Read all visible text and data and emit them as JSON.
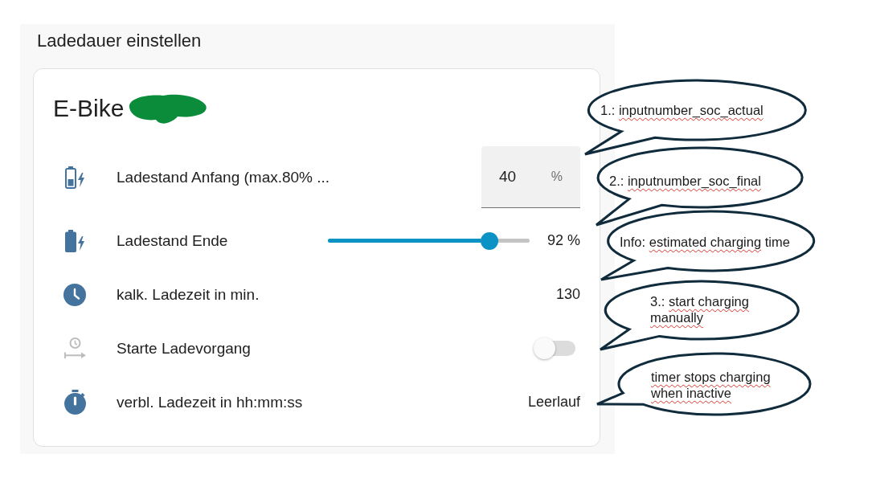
{
  "section_title": "Ladedauer einstellen",
  "card": {
    "title": "E-Bike",
    "redacted": true,
    "rows": [
      {
        "kind": "number",
        "label": "Ladestand Anfang (max.80% ...",
        "value": "40",
        "unit": "%"
      },
      {
        "kind": "slider",
        "label": "Ladestand Ende",
        "level": 0.8,
        "reading": "92 %"
      },
      {
        "kind": "value",
        "label": "kalk. Ladezeit in min.",
        "value": "130"
      },
      {
        "kind": "toggle",
        "label": "Starte Ladevorgang",
        "on": false
      },
      {
        "kind": "value",
        "label": "verbl. Ladezeit in hh:mm:ss",
        "value": "Leerlauf"
      }
    ]
  },
  "callouts": [
    {
      "segments": [
        {
          "text": "1.: ",
          "spellcheck_error": false
        },
        {
          "text": "inputnumber_soc_actual",
          "spellcheck_error": true
        }
      ]
    },
    {
      "segments": [
        {
          "text": "2.: ",
          "spellcheck_error": false
        },
        {
          "text": "inputnumber_soc_final",
          "spellcheck_error": true
        }
      ]
    },
    {
      "segments": [
        {
          "text": "Info: ",
          "spellcheck_error": false
        },
        {
          "text": "estimated charging",
          "spellcheck_error": true
        },
        {
          "text": " time",
          "spellcheck_error": false
        }
      ]
    },
    {
      "segments": [
        {
          "text": "3.: ",
          "spellcheck_error": false
        },
        {
          "text": "start charging manually",
          "spellcheck_error": true
        }
      ]
    },
    {
      "segments": [
        {
          "text": "timer stops charging when inactive",
          "spellcheck_error": true
        }
      ]
    }
  ]
}
